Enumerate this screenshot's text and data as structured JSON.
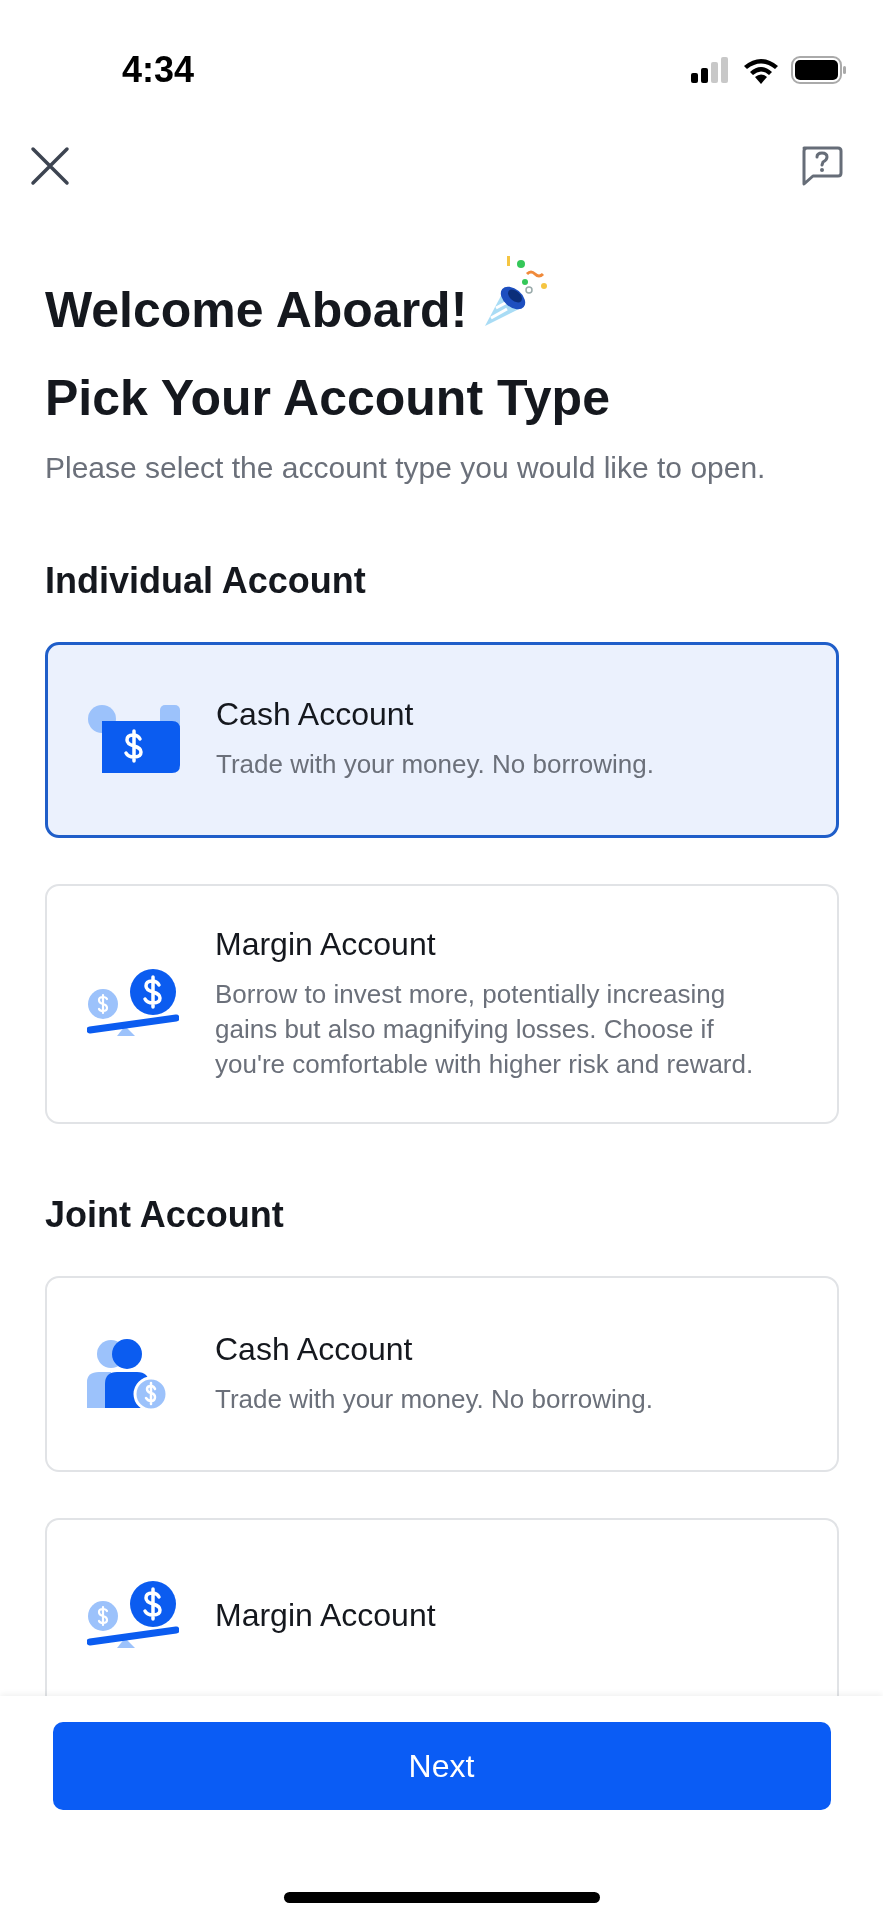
{
  "status_bar": {
    "time": "4:34"
  },
  "header": {
    "title": "Welcome Aboard!",
    "subtitle": "Pick Your Account Type",
    "description": "Please select the account type you would like to open."
  },
  "sections": [
    {
      "title": "Individual Account",
      "options": [
        {
          "title": "Cash Account",
          "description": "Trade with your money. No borrowing.",
          "selected": true
        },
        {
          "title": "Margin Account",
          "description": "Borrow to invest more, potentially increasing gains but also magnifying losses. Choose if you're comfortable with higher risk and reward.",
          "selected": false
        }
      ]
    },
    {
      "title": "Joint Account",
      "options": [
        {
          "title": "Cash Account",
          "description": "Trade with your money. No borrowing.",
          "selected": false
        },
        {
          "title": "Margin Account",
          "selected": false
        }
      ]
    }
  ],
  "next_button": "Next"
}
